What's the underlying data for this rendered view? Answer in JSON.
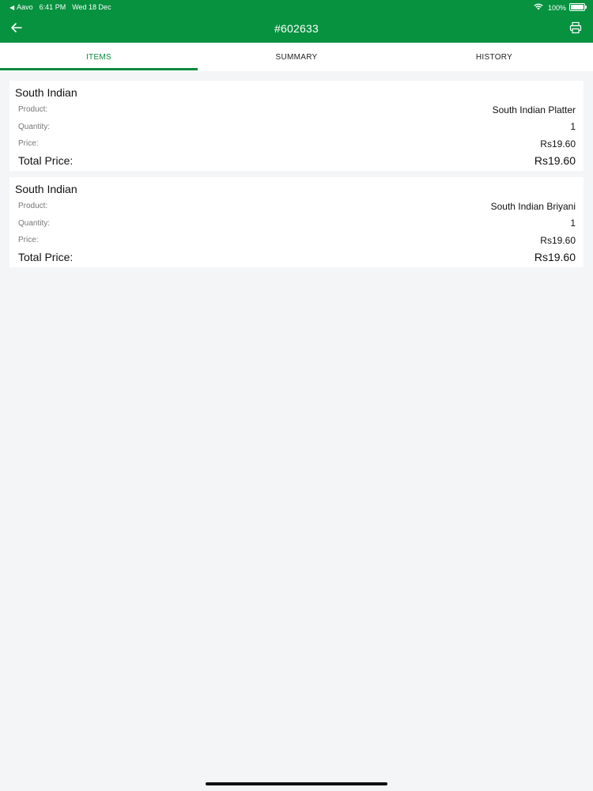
{
  "status_bar": {
    "back_app": "Aavo",
    "time": "6:41 PM",
    "date": "Wed 18 Dec",
    "battery": "100%"
  },
  "header": {
    "title": "#602633"
  },
  "tabs": [
    {
      "label": "ITEMS",
      "active": true
    },
    {
      "label": "SUMMARY",
      "active": false
    },
    {
      "label": "HISTORY",
      "active": false
    }
  ],
  "items": [
    {
      "category": "South Indian",
      "product_label": "Product:",
      "product": "South Indian Platter",
      "quantity_label": "Quantity:",
      "quantity": "1",
      "price_label": "Price:",
      "price": "Rs19.60",
      "total_label": "Total Price:",
      "total": "Rs19.60"
    },
    {
      "category": "South Indian",
      "product_label": "Product:",
      "product": "South Indian Briyani",
      "quantity_label": "Quantity:",
      "quantity": "1",
      "price_label": "Price:",
      "price": "Rs19.60",
      "total_label": "Total Price:",
      "total": "Rs19.60"
    }
  ],
  "colors": {
    "brand": "#06923f",
    "tab_active": "#0a8a3c",
    "background": "#f4f5f6"
  },
  "icons": {
    "back": "arrow-left-icon",
    "print": "printer-icon",
    "wifi": "wifi-icon",
    "battery": "battery-icon"
  }
}
